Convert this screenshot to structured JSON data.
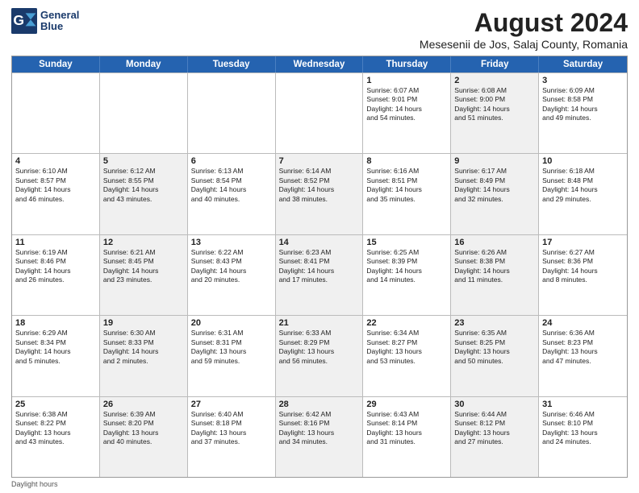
{
  "header": {
    "logo_line1": "General",
    "logo_line2": "Blue",
    "main_title": "August 2024",
    "subtitle": "Mesesenii de Jos, Salaj County, Romania"
  },
  "days_of_week": [
    "Sunday",
    "Monday",
    "Tuesday",
    "Wednesday",
    "Thursday",
    "Friday",
    "Saturday"
  ],
  "footer_text": "Daylight hours",
  "weeks": [
    [
      {
        "day": "",
        "info": "",
        "shaded": false
      },
      {
        "day": "",
        "info": "",
        "shaded": false
      },
      {
        "day": "",
        "info": "",
        "shaded": false
      },
      {
        "day": "",
        "info": "",
        "shaded": false
      },
      {
        "day": "1",
        "info": "Sunrise: 6:07 AM\nSunset: 9:01 PM\nDaylight: 14 hours\nand 54 minutes.",
        "shaded": false
      },
      {
        "day": "2",
        "info": "Sunrise: 6:08 AM\nSunset: 9:00 PM\nDaylight: 14 hours\nand 51 minutes.",
        "shaded": true
      },
      {
        "day": "3",
        "info": "Sunrise: 6:09 AM\nSunset: 8:58 PM\nDaylight: 14 hours\nand 49 minutes.",
        "shaded": false
      }
    ],
    [
      {
        "day": "4",
        "info": "Sunrise: 6:10 AM\nSunset: 8:57 PM\nDaylight: 14 hours\nand 46 minutes.",
        "shaded": false
      },
      {
        "day": "5",
        "info": "Sunrise: 6:12 AM\nSunset: 8:55 PM\nDaylight: 14 hours\nand 43 minutes.",
        "shaded": true
      },
      {
        "day": "6",
        "info": "Sunrise: 6:13 AM\nSunset: 8:54 PM\nDaylight: 14 hours\nand 40 minutes.",
        "shaded": false
      },
      {
        "day": "7",
        "info": "Sunrise: 6:14 AM\nSunset: 8:52 PM\nDaylight: 14 hours\nand 38 minutes.",
        "shaded": true
      },
      {
        "day": "8",
        "info": "Sunrise: 6:16 AM\nSunset: 8:51 PM\nDaylight: 14 hours\nand 35 minutes.",
        "shaded": false
      },
      {
        "day": "9",
        "info": "Sunrise: 6:17 AM\nSunset: 8:49 PM\nDaylight: 14 hours\nand 32 minutes.",
        "shaded": true
      },
      {
        "day": "10",
        "info": "Sunrise: 6:18 AM\nSunset: 8:48 PM\nDaylight: 14 hours\nand 29 minutes.",
        "shaded": false
      }
    ],
    [
      {
        "day": "11",
        "info": "Sunrise: 6:19 AM\nSunset: 8:46 PM\nDaylight: 14 hours\nand 26 minutes.",
        "shaded": false
      },
      {
        "day": "12",
        "info": "Sunrise: 6:21 AM\nSunset: 8:45 PM\nDaylight: 14 hours\nand 23 minutes.",
        "shaded": true
      },
      {
        "day": "13",
        "info": "Sunrise: 6:22 AM\nSunset: 8:43 PM\nDaylight: 14 hours\nand 20 minutes.",
        "shaded": false
      },
      {
        "day": "14",
        "info": "Sunrise: 6:23 AM\nSunset: 8:41 PM\nDaylight: 14 hours\nand 17 minutes.",
        "shaded": true
      },
      {
        "day": "15",
        "info": "Sunrise: 6:25 AM\nSunset: 8:39 PM\nDaylight: 14 hours\nand 14 minutes.",
        "shaded": false
      },
      {
        "day": "16",
        "info": "Sunrise: 6:26 AM\nSunset: 8:38 PM\nDaylight: 14 hours\nand 11 minutes.",
        "shaded": true
      },
      {
        "day": "17",
        "info": "Sunrise: 6:27 AM\nSunset: 8:36 PM\nDaylight: 14 hours\nand 8 minutes.",
        "shaded": false
      }
    ],
    [
      {
        "day": "18",
        "info": "Sunrise: 6:29 AM\nSunset: 8:34 PM\nDaylight: 14 hours\nand 5 minutes.",
        "shaded": false
      },
      {
        "day": "19",
        "info": "Sunrise: 6:30 AM\nSunset: 8:33 PM\nDaylight: 14 hours\nand 2 minutes.",
        "shaded": true
      },
      {
        "day": "20",
        "info": "Sunrise: 6:31 AM\nSunset: 8:31 PM\nDaylight: 13 hours\nand 59 minutes.",
        "shaded": false
      },
      {
        "day": "21",
        "info": "Sunrise: 6:33 AM\nSunset: 8:29 PM\nDaylight: 13 hours\nand 56 minutes.",
        "shaded": true
      },
      {
        "day": "22",
        "info": "Sunrise: 6:34 AM\nSunset: 8:27 PM\nDaylight: 13 hours\nand 53 minutes.",
        "shaded": false
      },
      {
        "day": "23",
        "info": "Sunrise: 6:35 AM\nSunset: 8:25 PM\nDaylight: 13 hours\nand 50 minutes.",
        "shaded": true
      },
      {
        "day": "24",
        "info": "Sunrise: 6:36 AM\nSunset: 8:23 PM\nDaylight: 13 hours\nand 47 minutes.",
        "shaded": false
      }
    ],
    [
      {
        "day": "25",
        "info": "Sunrise: 6:38 AM\nSunset: 8:22 PM\nDaylight: 13 hours\nand 43 minutes.",
        "shaded": false
      },
      {
        "day": "26",
        "info": "Sunrise: 6:39 AM\nSunset: 8:20 PM\nDaylight: 13 hours\nand 40 minutes.",
        "shaded": true
      },
      {
        "day": "27",
        "info": "Sunrise: 6:40 AM\nSunset: 8:18 PM\nDaylight: 13 hours\nand 37 minutes.",
        "shaded": false
      },
      {
        "day": "28",
        "info": "Sunrise: 6:42 AM\nSunset: 8:16 PM\nDaylight: 13 hours\nand 34 minutes.",
        "shaded": true
      },
      {
        "day": "29",
        "info": "Sunrise: 6:43 AM\nSunset: 8:14 PM\nDaylight: 13 hours\nand 31 minutes.",
        "shaded": false
      },
      {
        "day": "30",
        "info": "Sunrise: 6:44 AM\nSunset: 8:12 PM\nDaylight: 13 hours\nand 27 minutes.",
        "shaded": true
      },
      {
        "day": "31",
        "info": "Sunrise: 6:46 AM\nSunset: 8:10 PM\nDaylight: 13 hours\nand 24 minutes.",
        "shaded": false
      }
    ]
  ]
}
